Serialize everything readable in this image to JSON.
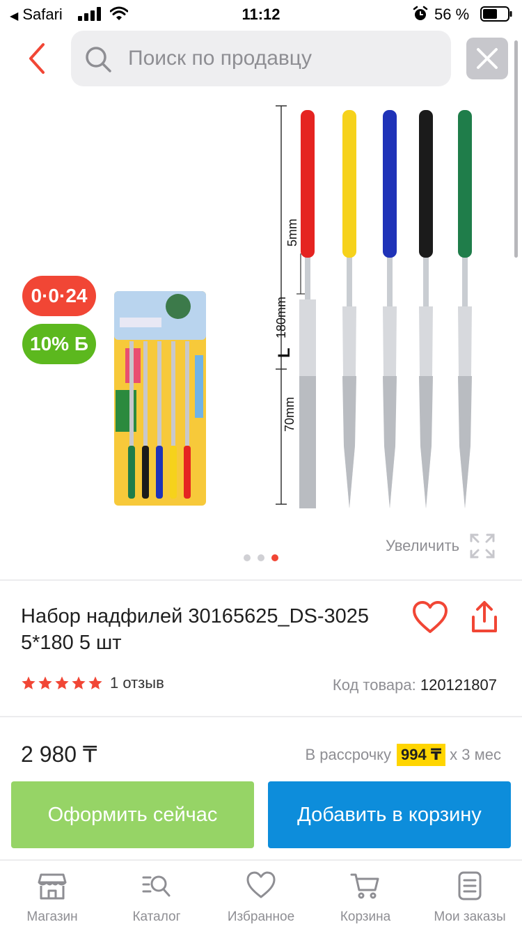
{
  "status_bar": {
    "app_back": "Safari",
    "time": "11:12",
    "battery": "56 %"
  },
  "search": {
    "placeholder": "Поиск по продавцу",
    "value": ""
  },
  "gallery": {
    "badge_installment": "0·0·24",
    "badge_bonus": "10% Б",
    "zoom_label": "Увеличить",
    "image_labels": {
      "handle_length": "5mm",
      "total_length": "180mm",
      "length_marker": "L",
      "file_length": "70mm"
    },
    "handle_colors": [
      "#e52421",
      "#f6d21b",
      "#1f33b8",
      "#1b1b1b",
      "#1f7d4a"
    ],
    "page_count": 3,
    "active_page": 3
  },
  "product": {
    "title": "Набор надфилей 30165625_DS-3025 5*180 5 шт",
    "rating": 5,
    "reviews": "1 отзыв",
    "code_label": "Код товара:",
    "code_value": "120121807"
  },
  "price": {
    "value": "2 980 ₸",
    "installment_prefix": "В рассрочку",
    "installment_amount": "994 ₸",
    "installment_suffix": "х 3 мес"
  },
  "actions": {
    "buy_now": "Оформить сейчас",
    "add_to_cart": "Добавить в корзину"
  },
  "tabbar": {
    "items": [
      {
        "label": "Магазин",
        "icon": "store-icon"
      },
      {
        "label": "Каталог",
        "icon": "catalog-search-icon"
      },
      {
        "label": "Избранное",
        "icon": "heart-icon"
      },
      {
        "label": "Корзина",
        "icon": "cart-icon"
      },
      {
        "label": "Мои заказы",
        "icon": "orders-icon"
      }
    ]
  },
  "colors": {
    "accent_red": "#f14635",
    "bonus_green": "#5cb81e",
    "buy_green": "#96d466",
    "cart_blue": "#0d8ddb",
    "installment_yellow": "#ffd500"
  }
}
